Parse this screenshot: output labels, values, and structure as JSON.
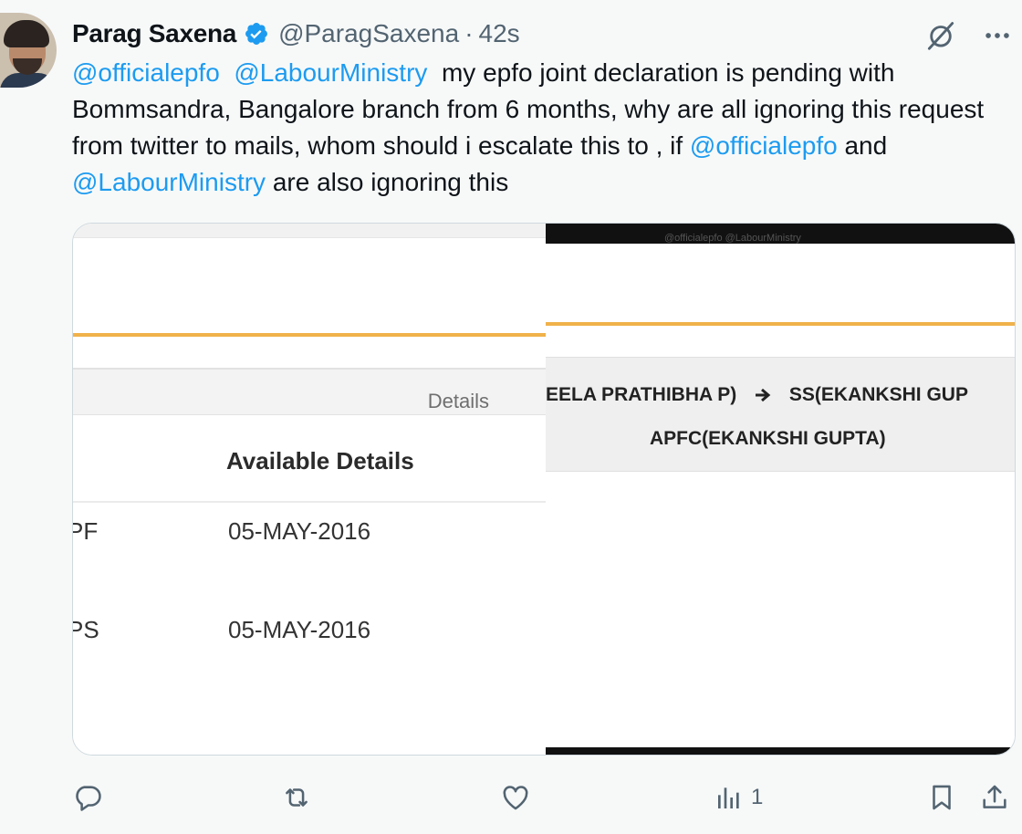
{
  "tweet": {
    "author": {
      "display_name": "Parag Saxena",
      "handle": "@ParagSaxena",
      "verified_icon": "verified-badge-icon",
      "time_separator": "·",
      "timestamp": "42s"
    },
    "text": {
      "mention_1": "@officialepfo",
      "mention_2": "@LabourMinistry",
      "part_1": "my epfo joint declaration is pending with Bommsandra, Bangalore branch from 6 months, why are all ignoring this request from twitter to mails, whom should i escalate this to , if",
      "mention_3": "@officialepfo",
      "part_2": "and",
      "mention_4": "@LabourMinistry",
      "part_3": "are also ignoring this"
    },
    "media": {
      "left_image": {
        "details_header": "Details",
        "column_header": "Available Details",
        "rows": [
          {
            "label": "PF",
            "value": "05-MAY-2016"
          },
          {
            "label": "PS",
            "value": "05-MAY-2016"
          }
        ]
      },
      "right_image": {
        "watermark": "@officialepfo @LabourMinistry",
        "workflow_from": "EELA PRATHIBHA P)",
        "workflow_to": "SS(EKANKSHI GUP",
        "workflow_next": "APFC(EKANKSHI GUPTA)"
      }
    },
    "actions": {
      "reply_icon": "reply-icon",
      "retweet_icon": "retweet-icon",
      "like_icon": "heart-icon",
      "views_icon": "views-icon",
      "views_count": "1",
      "bookmark_icon": "bookmark-icon",
      "share_icon": "share-icon",
      "grok_icon": "grok-icon",
      "more_icon": "more-icon"
    },
    "colors": {
      "link": "#1d9bf0",
      "muted": "#536471",
      "verified": "#1d9bf0",
      "accent_orange": "#f0b24a"
    }
  }
}
